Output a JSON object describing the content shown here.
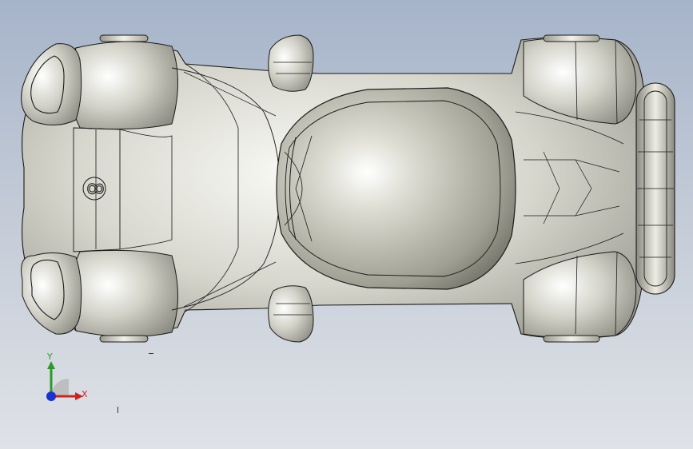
{
  "viewport": {
    "background_top": "#a6b4ca",
    "background_bottom": "#dfe2e7"
  },
  "model": {
    "name": "car-body-top-view",
    "part_number": "8",
    "surface_color": "#d8d8d0",
    "edge_color": "#1a1a1a"
  },
  "triad": {
    "y_label": "Y",
    "x_label": "X",
    "y_color": "#2a9a2a",
    "x_color": "#d22020",
    "z_color": "#1a32d0"
  }
}
